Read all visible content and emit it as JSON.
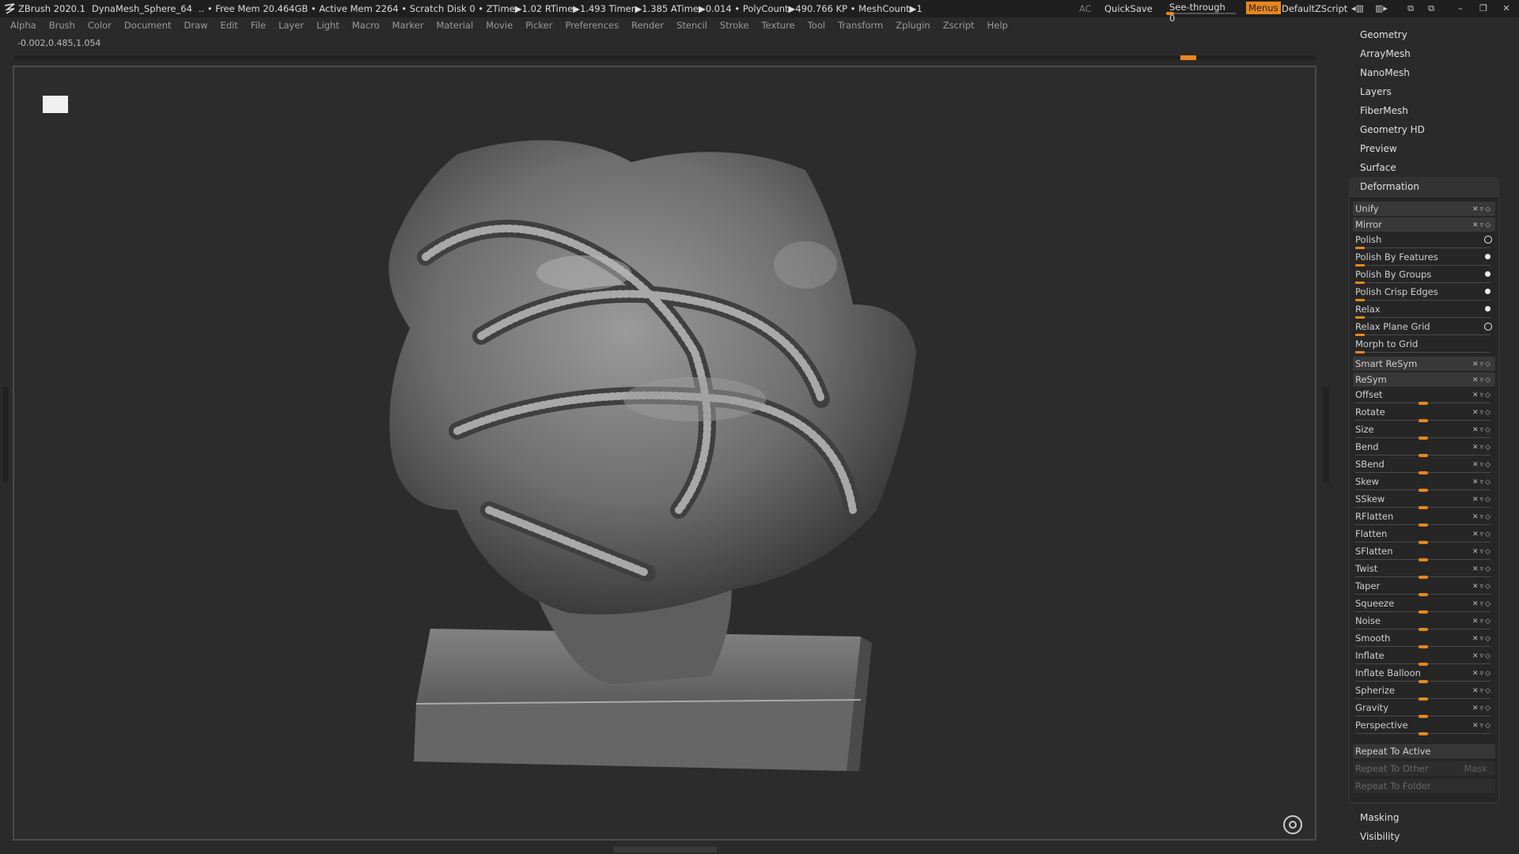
{
  "titlebar": {
    "app": "ZBrush 2020.1",
    "document": "DynaMesh_Sphere_64",
    "status": "..  • Free Mem 20.464GB • Active Mem 2264 • Scratch Disk 0 •  ZTime▶1.02 RTime▶1.493 Timer▶1.385 ATime▶0.014 • PolyCount▶490.766 KP  • MeshCount▶1",
    "ac": "AC",
    "quicksave": "QuickSave",
    "seethrough_label": "See-through",
    "seethrough_value": "0",
    "menus": "Menus",
    "script": "DefaultZScript"
  },
  "menubar": {
    "items": [
      "Alpha",
      "Brush",
      "Color",
      "Document",
      "Draw",
      "Edit",
      "File",
      "Layer",
      "Light",
      "Macro",
      "Marker",
      "Material",
      "Movie",
      "Picker",
      "Preferences",
      "Render",
      "Stencil",
      "Stroke",
      "Texture",
      "Tool",
      "Transform",
      "Zplugin",
      "Zscript",
      "Help"
    ]
  },
  "coords": "-0.002,0.485,1.054",
  "panel": {
    "categories_top": [
      "Geometry",
      "ArrayMesh",
      "NanoMesh",
      "Layers",
      "FiberMesh",
      "Geometry HD",
      "Preview",
      "Surface"
    ],
    "open_category": "Deformation",
    "buttons": [
      {
        "label": "Unify",
        "icons": "xyz"
      },
      {
        "label": "Mirror",
        "icons": "xyz"
      }
    ],
    "polish_rows": [
      {
        "label": "Polish",
        "indicator": "ring"
      },
      {
        "label": "Polish By Features",
        "indicator": "dot"
      },
      {
        "label": "Polish By Groups",
        "indicator": "dot"
      },
      {
        "label": "Polish Crisp Edges",
        "indicator": "dot"
      },
      {
        "label": "Relax",
        "indicator": "dot"
      },
      {
        "label": "Relax Plane Grid",
        "indicator": "ring"
      },
      {
        "label": "Morph to Grid",
        "indicator": "none"
      }
    ],
    "sym_buttons": [
      {
        "label": "Smart ReSym",
        "icons": "xyz"
      },
      {
        "label": "ReSym",
        "icons": "xyz"
      }
    ],
    "sliders": [
      "Offset",
      "Rotate",
      "Size",
      "Bend",
      "SBend",
      "Skew",
      "SSkew",
      "RFlatten",
      "Flatten",
      "SFlatten",
      "Twist",
      "Taper",
      "Squeeze",
      "Noise",
      "Smooth",
      "Inflate",
      "Inflate Balloon",
      "Spherize",
      "Gravity",
      "Perspective"
    ],
    "repeat_active": "Repeat To Active",
    "repeat_other": "Repeat To Other",
    "mask": "Mask",
    "repeat_folder": "Repeat To Folder",
    "categories_bottom": [
      "Masking",
      "Visibility"
    ]
  },
  "colors": {
    "accent": "#e8861f",
    "background": "#2a2a2a",
    "panel": "#262626"
  }
}
